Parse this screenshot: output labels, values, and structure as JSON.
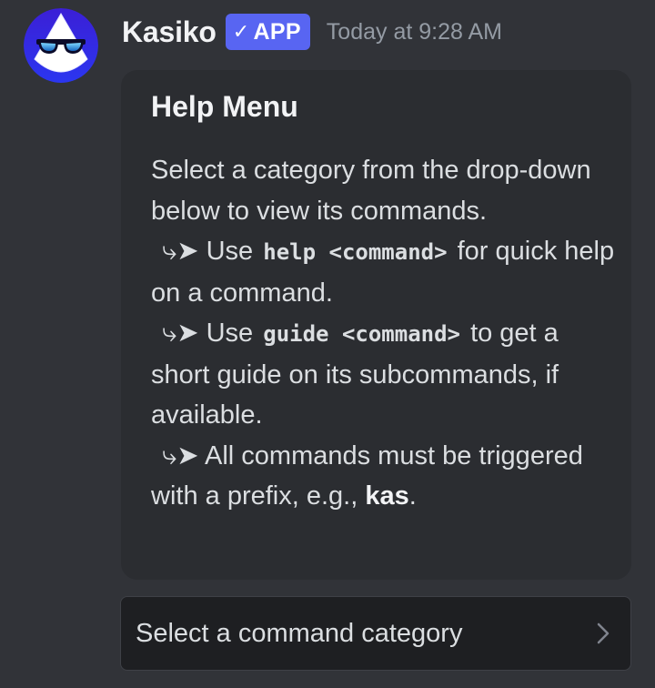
{
  "message": {
    "author": "Kasiko",
    "badge": "APP",
    "badge_check": "✓",
    "timestamp": "Today at 9:28 AM",
    "avatar_icon": "sunglasses-avatar-icon"
  },
  "embed": {
    "title": "Help Menu",
    "intro": "Select a category from the drop-down below to view its commands.",
    "arrow_glyph": "⤷➤",
    "line1": {
      "prefix": "Use",
      "code": "help <command>",
      "suffix": "for quick help on a command."
    },
    "line2": {
      "prefix": "Use",
      "code": "guide <command>",
      "suffix": "to get a short guide on its subcommands, if available."
    },
    "line3": {
      "text": "All commands must be triggered with a prefix, e.g.,",
      "prefix_value": "kas",
      "end": "."
    }
  },
  "select_menu": {
    "placeholder": "Select a command category",
    "icon": "chevron-right-icon"
  },
  "colors": {
    "background": "#313338",
    "embed_background": "#2b2d31",
    "select_background": "#1e1f22",
    "badge": "#5865f2",
    "timestamp": "#949ba4"
  }
}
